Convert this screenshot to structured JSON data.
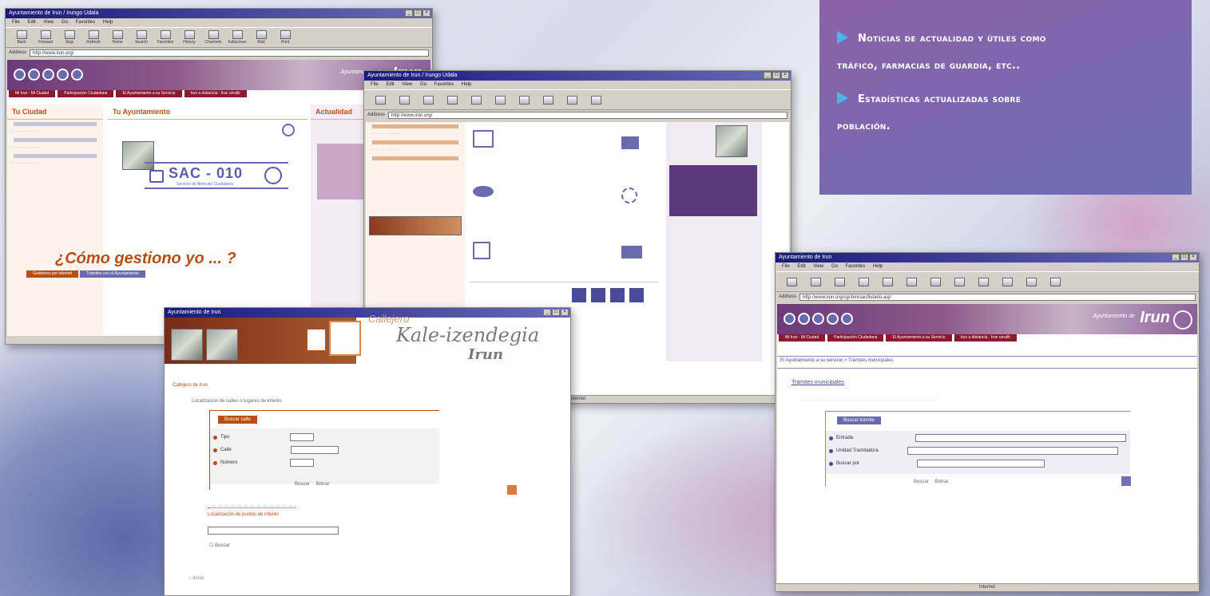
{
  "info_panel": {
    "items": [
      "Noticias de actualidad y útiles como",
      "tráfico, farmacias de guardia, etc..",
      "Estadísticas actualizadas sobre",
      "población."
    ]
  },
  "window1": {
    "title": "Ayuntamiento de Irun / Irungo Udala",
    "menu": "File Edit View Go Favorites Help",
    "address_label": "Address",
    "address": "http://www.irun.org/",
    "toolbar": [
      "Back",
      "Forward",
      "Stop",
      "Refresh",
      "Home",
      "Search",
      "Favorites",
      "History",
      "Channels",
      "Fullscreen",
      "Mail",
      "Print"
    ],
    "brand": "Irun",
    "brand_sub": "Ayuntamiento de",
    "nav": [
      "Mi Irun · Mi Ciudad",
      "Participación Ciudadana",
      "El Ayuntamiento a su Servicio",
      "Irun a distancia · Irun urrutik"
    ],
    "col1_title": "Tu Ciudad",
    "col2_title": "Tu Ayuntamiento",
    "col3_title": "Actualidad",
    "sac_text": "SAC - 010",
    "sac_sub": "Servicio de Atención Ciudadana",
    "como": "¿Cómo gestiono yo ... ?",
    "como_tab_1": "Gestiones por internet",
    "como_tab_2": "Trámites con el Ayuntamiento"
  },
  "window2": {
    "title": "Ayuntamiento de Irun / Irungo Udala",
    "menu": "File Edit View Go Favorites Help",
    "address_label": "Address",
    "address": "http://www.irun.org/",
    "status": "Internet"
  },
  "window3": {
    "title": "Ayuntamiento de Irun",
    "kale_sub": "Callejero",
    "kale_title": "Kale-izendegia",
    "kale_irun": "Irun",
    "breadcrumb": "Callejero de Irun",
    "intro": "Localización de calles o lugares de interés",
    "form_tab": "Buscar calle",
    "fields": [
      "Tipo",
      "Calle",
      "Número"
    ],
    "buttons": [
      "Buscar",
      "Borrar"
    ],
    "section2": "Localización de puntos de interés",
    "check": "Buscar",
    "footer": "Inicio"
  },
  "window4": {
    "title": "Ayuntamiento de Irun",
    "menu": "File Edit View Go Favorites Help",
    "address_label": "Address",
    "address": "http://www.irun.org/cgi-bin/sac/listado.asp",
    "brand": "Irun",
    "brand_sub": "Ayuntamiento de",
    "nav": [
      "Mi Irun · Mi Ciudad",
      "Participación Ciudadana",
      "El Ayuntamiento a su Servicio",
      "Irun a distancia · Irun urrutik"
    ],
    "breadcrumb": "El Ayuntamiento a su servicio > Trámites municipales",
    "page_title": "Trámites municipales",
    "form_tab": "Buscar trámite",
    "fields": [
      "Entrada",
      "Unidad Tramitadora",
      "Buscar por"
    ],
    "buttons": [
      "Buscar",
      "Borrar"
    ],
    "status": "Internet"
  }
}
